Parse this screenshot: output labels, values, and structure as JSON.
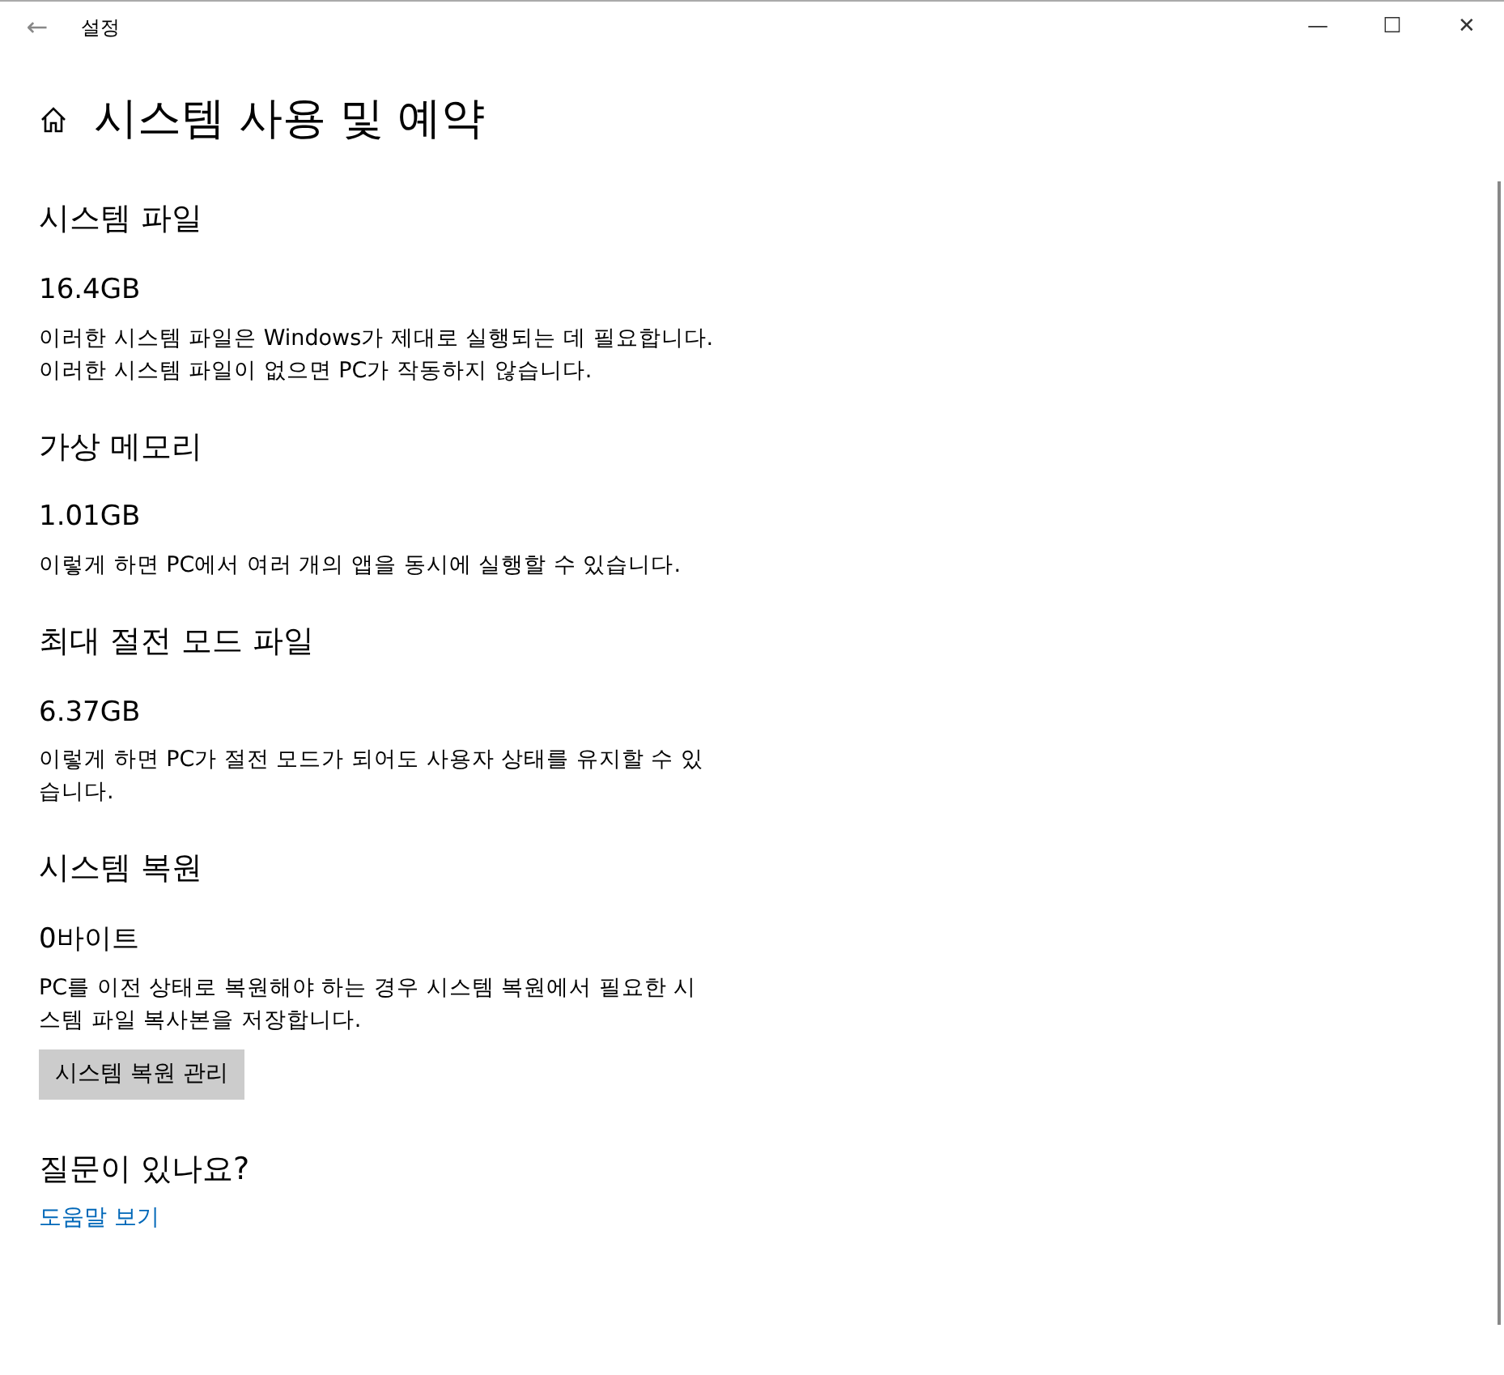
{
  "window": {
    "title": "설정",
    "back": "←",
    "controls": [
      "—",
      "☐",
      "✕"
    ]
  },
  "page": {
    "title": "시스템 사용 및 예약"
  },
  "sections": [
    {
      "title": "시스템 파일",
      "value": "16.4GB",
      "description_lines": [
        "이러한 시스템 파일은 Windows가 제대로 실행되는 데 필요합니다.",
        "이러한 시스템 파일이 없으면 PC가 작동하지 않습니다."
      ]
    },
    {
      "title": "가상 메모리",
      "value": "1.01GB",
      "description_lines": [
        "이렇게 하면 PC에서 여러 개의 앱을 동시에 실행할 수 있습니다."
      ]
    },
    {
      "title": "최대 절전 모드 파일",
      "value": "6.37GB",
      "description_lines": [
        "이렇게 하면 PC가 절전 모드가 되어도 사용자 상태를 유지할 수 있",
        "습니다."
      ]
    },
    {
      "title": "시스템 복원",
      "value": "0바이트",
      "description_lines": [
        "PC를 이전 상태로 복원해야 하는 경우 시스템 복원에서 필요한 시",
        "스템 파일 복사본을 저장합니다."
      ],
      "button": "시스템 복원 관리"
    }
  ],
  "help": {
    "title": "질문이 있나요?",
    "link": "도움말 보기"
  }
}
